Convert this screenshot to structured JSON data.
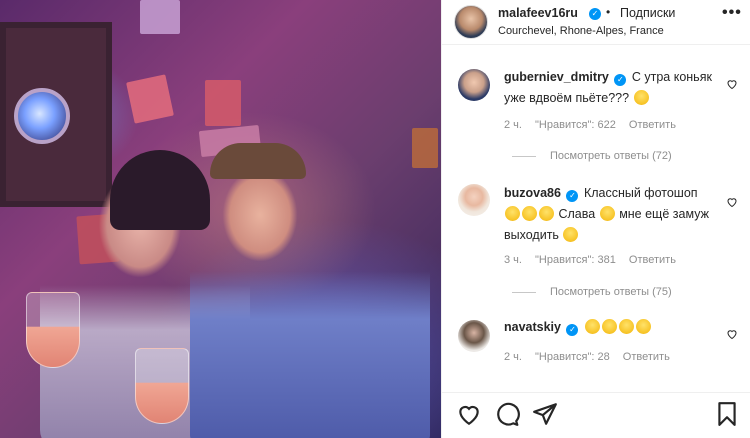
{
  "post": {
    "author": "malafeev16ru",
    "follow_label": "Подписки",
    "separator": "•",
    "location": "Courchevel, Rhone-Alpes, France",
    "more": "•••"
  },
  "comments": [
    {
      "username": "guberniev_dmitry",
      "text": "С утра коньяк уже вдвоём пьёте???",
      "time": "2 ч.",
      "likes": "\"Нравится\": 622",
      "reply": "Ответить",
      "view_replies": "Посмотреть ответы (72)"
    },
    {
      "username": "buzova86",
      "text_a": "Классный фотошоп",
      "text_b": "Слава",
      "text_c": "мне ещё замуж выходить",
      "time": "3 ч.",
      "likes": "\"Нравится\": 381",
      "reply": "Ответить",
      "view_replies": "Посмотреть ответы (75)"
    },
    {
      "username": "navatskiy",
      "time": "2 ч.",
      "likes": "\"Нравится\": 28",
      "reply": "Ответить"
    }
  ],
  "icons": {
    "verified": "verified-badge-icon",
    "like": "heart-icon",
    "comment": "comment-icon",
    "share": "share-icon",
    "save": "bookmark-icon"
  },
  "colors": {
    "verified": "#0095f6",
    "muted": "#8e8e8e",
    "text": "#262626"
  }
}
